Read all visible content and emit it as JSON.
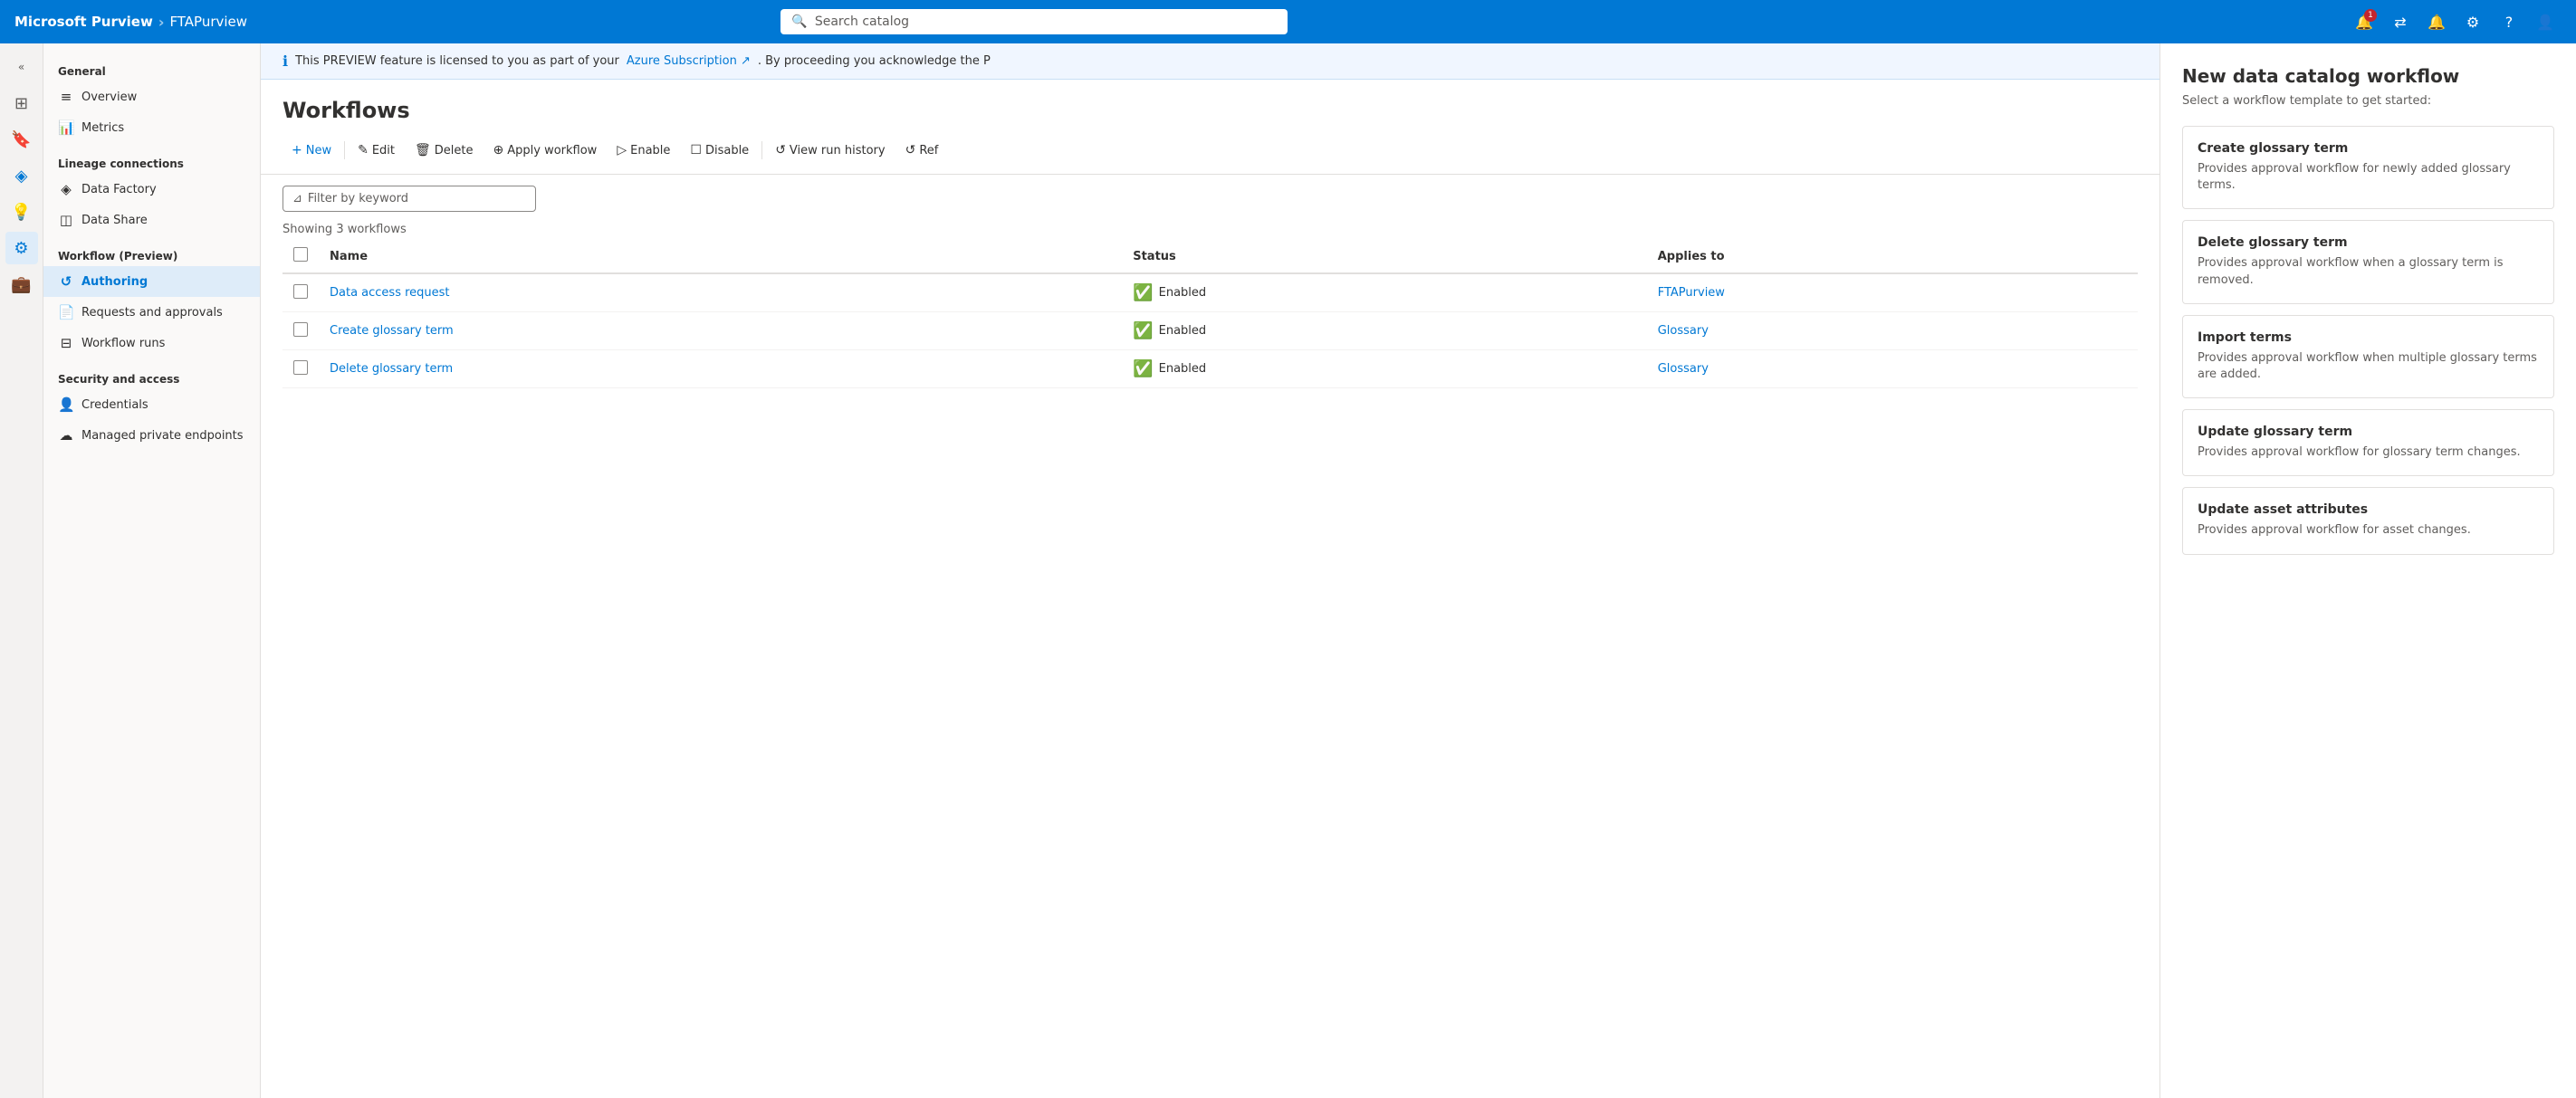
{
  "topnav": {
    "brand": "Microsoft Purview",
    "separator": "›",
    "sub_title": "FTAPurview",
    "search_placeholder": "Search catalog",
    "icons": [
      "notification",
      "switch-directory",
      "bell",
      "settings",
      "help",
      "profile"
    ],
    "notification_count": "1"
  },
  "icon_sidebar": {
    "items": [
      {
        "name": "expand-icon",
        "symbol": "«",
        "active": false
      },
      {
        "name": "home-icon",
        "symbol": "⊞",
        "active": false
      },
      {
        "name": "catalog-icon",
        "symbol": "🔖",
        "active": false
      },
      {
        "name": "lineage-icon",
        "symbol": "⬡",
        "active": false
      },
      {
        "name": "insights-icon",
        "symbol": "💡",
        "active": false
      },
      {
        "name": "management-icon",
        "symbol": "⚙",
        "active": true
      },
      {
        "name": "briefcase-icon",
        "symbol": "💼",
        "active": false
      }
    ]
  },
  "sidebar": {
    "sections": [
      {
        "label": "General",
        "items": [
          {
            "label": "Overview",
            "icon": "≡",
            "active": false,
            "name": "overview"
          },
          {
            "label": "Metrics",
            "icon": "📊",
            "active": false,
            "name": "metrics"
          }
        ]
      },
      {
        "label": "Lineage connections",
        "items": [
          {
            "label": "Data Factory",
            "icon": "⬡",
            "active": false,
            "name": "data-factory"
          },
          {
            "label": "Data Share",
            "icon": "◫",
            "active": false,
            "name": "data-share"
          }
        ]
      },
      {
        "label": "Workflow (Preview)",
        "items": [
          {
            "label": "Authoring",
            "icon": "↺",
            "active": true,
            "name": "authoring"
          },
          {
            "label": "Requests and approvals",
            "icon": "📄",
            "active": false,
            "name": "requests-approvals"
          },
          {
            "label": "Workflow runs",
            "icon": "⊟",
            "active": false,
            "name": "workflow-runs"
          }
        ]
      },
      {
        "label": "Security and access",
        "items": [
          {
            "label": "Credentials",
            "icon": "👤",
            "active": false,
            "name": "credentials"
          },
          {
            "label": "Managed private endpoints",
            "icon": "☁",
            "active": false,
            "name": "managed-private-endpoints"
          }
        ]
      }
    ]
  },
  "info_banner": {
    "text": "This PREVIEW feature is licensed to you as part of your",
    "link_text": "Azure Subscription ↗",
    "text2": ". By proceeding you acknowledge the P"
  },
  "page": {
    "title": "Workflows",
    "toolbar": {
      "buttons": [
        {
          "label": "New",
          "icon": "+",
          "name": "new-button",
          "primary": true
        },
        {
          "label": "Edit",
          "icon": "✎",
          "name": "edit-button"
        },
        {
          "label": "Delete",
          "icon": "🗑",
          "name": "delete-button"
        },
        {
          "label": "Apply workflow",
          "icon": "⊕",
          "name": "apply-workflow-button"
        },
        {
          "label": "Enable",
          "icon": "▷",
          "name": "enable-button"
        },
        {
          "label": "Disable",
          "icon": "☐",
          "name": "disable-button"
        },
        {
          "label": "View run history",
          "icon": "↺",
          "name": "view-run-history-button"
        },
        {
          "label": "Ref",
          "icon": "↺",
          "name": "refresh-button"
        }
      ]
    },
    "filter_placeholder": "Filter by keyword",
    "showing_label": "Showing 3 workflows",
    "table": {
      "columns": [
        "Name",
        "Status",
        "Applies to"
      ],
      "rows": [
        {
          "name": "Data access request",
          "status": "Enabled",
          "applies_to": "FTAPurview"
        },
        {
          "name": "Create glossary term",
          "status": "Enabled",
          "applies_to": "Glossary"
        },
        {
          "name": "Delete glossary term",
          "status": "Enabled",
          "applies_to": "Glossary"
        }
      ]
    }
  },
  "right_panel": {
    "title": "New data catalog workflow",
    "subtitle": "Select a workflow template to get started:",
    "templates": [
      {
        "title": "Create glossary term",
        "description": "Provides approval workflow for newly added glossary terms."
      },
      {
        "title": "Delete glossary term",
        "description": "Provides approval workflow when a glossary term is removed."
      },
      {
        "title": "Import terms",
        "description": "Provides approval workflow when multiple glossary terms are added."
      },
      {
        "title": "Update glossary term",
        "description": "Provides approval workflow for glossary term changes."
      },
      {
        "title": "Update asset attributes",
        "description": "Provides approval workflow for asset changes."
      }
    ]
  }
}
